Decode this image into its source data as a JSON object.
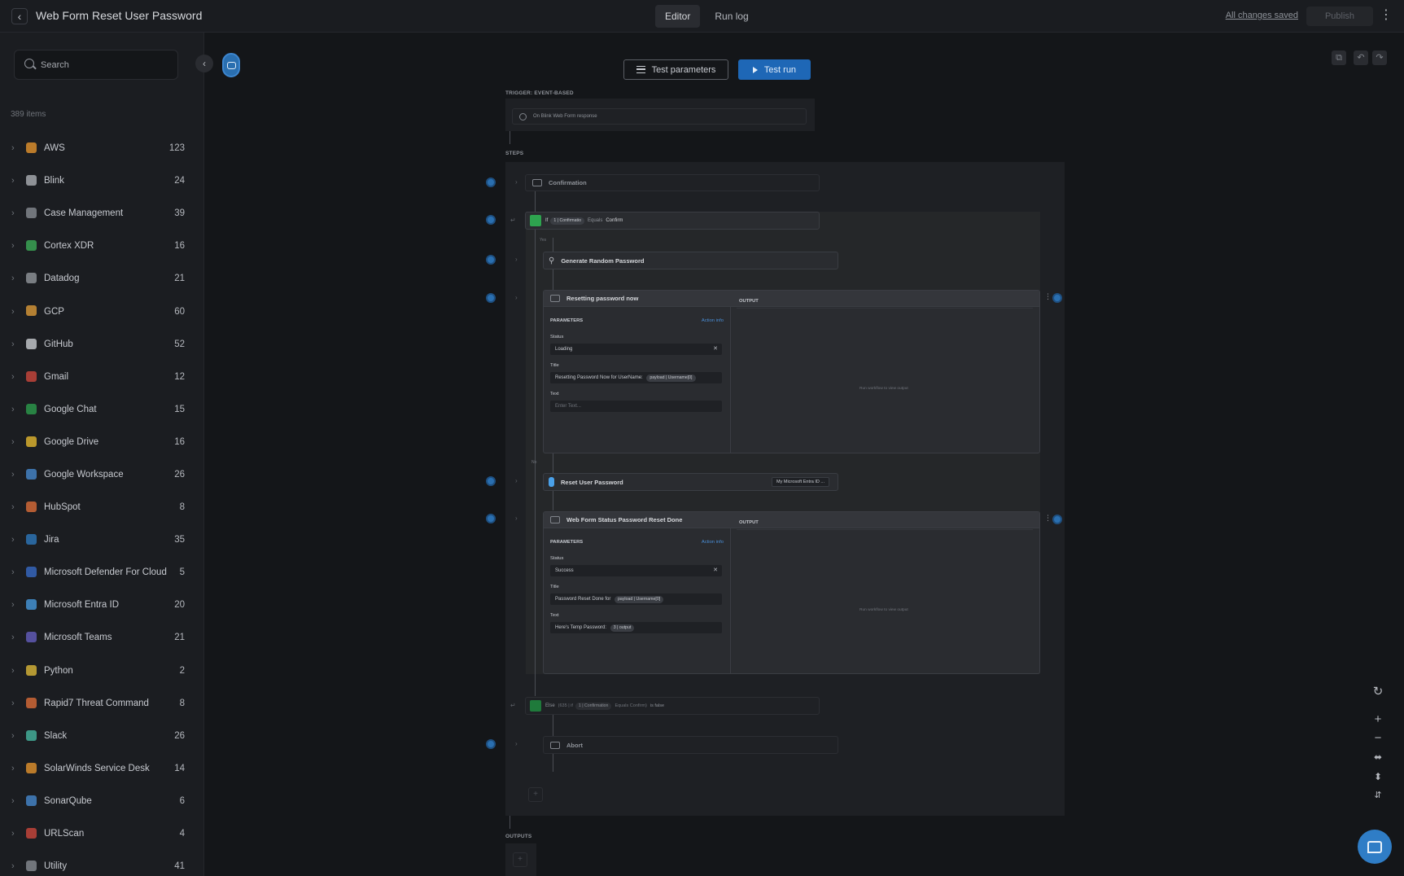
{
  "header": {
    "title": "Web Form Reset User Password",
    "tabs": [
      {
        "label": "Editor",
        "active": true
      },
      {
        "label": "Run log",
        "active": false
      }
    ],
    "save_status": "All changes saved",
    "publish_label": "Publish"
  },
  "sidebar": {
    "search_placeholder": "Search",
    "items_count": "389 items",
    "items": [
      {
        "label": "AWS",
        "count": "123",
        "color": "#f29b2e"
      },
      {
        "label": "Blink",
        "count": "24",
        "color": "#b5b8be"
      },
      {
        "label": "Case Management",
        "count": "39",
        "color": "#8f939a"
      },
      {
        "label": "Cortex XDR",
        "count": "16",
        "color": "#3fb65b"
      },
      {
        "label": "Datadog",
        "count": "21",
        "color": "#9a9da3"
      },
      {
        "label": "GCP",
        "count": "60",
        "color": "#e8a13a"
      },
      {
        "label": "GitHub",
        "count": "52",
        "color": "#d6d8dc"
      },
      {
        "label": "Gmail",
        "count": "12",
        "color": "#d84a3d"
      },
      {
        "label": "Google Chat",
        "count": "15",
        "color": "#2ea44f"
      },
      {
        "label": "Google Drive",
        "count": "16",
        "color": "#f2c230"
      },
      {
        "label": "Google Workspace",
        "count": "26",
        "color": "#4a8fd8"
      },
      {
        "label": "HubSpot",
        "count": "8",
        "color": "#e8713a"
      },
      {
        "label": "Jira",
        "count": "35",
        "color": "#2f7dc6"
      },
      {
        "label": "Microsoft Defender For Cloud",
        "count": "5",
        "color": "#3a6fd0"
      },
      {
        "label": "Microsoft Entra ID",
        "count": "20",
        "color": "#4aa0e8"
      },
      {
        "label": "Microsoft Teams",
        "count": "21",
        "color": "#6a62c8"
      },
      {
        "label": "Python",
        "count": "2",
        "color": "#e8c23a"
      },
      {
        "label": "Rapid7 Threat Command",
        "count": "8",
        "color": "#e8713a"
      },
      {
        "label": "Slack",
        "count": "26",
        "color": "#4ac0a8"
      },
      {
        "label": "SolarWinds Service Desk",
        "count": "14",
        "color": "#f29b2e"
      },
      {
        "label": "SonarQube",
        "count": "6",
        "color": "#4a8fd8"
      },
      {
        "label": "URLScan",
        "count": "4",
        "color": "#d84a3d"
      },
      {
        "label": "Utility",
        "count": "41",
        "color": "#8f939a"
      }
    ]
  },
  "canvas": {
    "test_params_label": "Test parameters",
    "test_run_label": "Test run",
    "trigger_label": "TRIGGER: EVENT-BASED",
    "trigger_text": "On Blink Web Form response",
    "steps_label": "STEPS",
    "outputs_label": "OUTPUTS",
    "confirmation_title": "Confirmation",
    "if_prefix": "If",
    "if_chip": "1 | Confirmatio",
    "if_op": "Equals",
    "if_value": "Confirm",
    "yes_label": "Yes",
    "no_label": "No",
    "gen_password_title": "Generate Random Password",
    "resetting": {
      "title": "Resetting password now",
      "params_label": "PARAMETERS",
      "action_info": "Action info",
      "status_label": "Status",
      "status_value": "Loading",
      "title_label": "Title",
      "title_value": "Resetting Password Now for UserName:",
      "title_chip": "payload | Username[0]",
      "text_label": "Text",
      "text_placeholder": "Enter Text...",
      "output_label": "OUTPUT",
      "output_empty": "Run workflow to view output"
    },
    "reset_user_title": "Reset User Password",
    "reset_user_conn": "My Microsoft Entra ID ...",
    "done": {
      "title": "Web Form Status Password Reset Done",
      "params_label": "PARAMETERS",
      "action_info": "Action info",
      "status_label": "Status",
      "status_value": "Success",
      "title_label": "Title",
      "title_value": "Password Reset Done for",
      "title_chip": "payload | Username[0]",
      "text_label": "Text",
      "text_value": "Here's Temp Password:",
      "text_chip": "3 | output",
      "output_label": "OUTPUT",
      "output_empty": "Run workflow to view output"
    },
    "else_text": "Else",
    "else_detail": "(635 | if",
    "else_chip": "1 | Confirmation",
    "else_op": "Equals Confirm)",
    "else_is": "is false",
    "abort_title": "Abort"
  }
}
